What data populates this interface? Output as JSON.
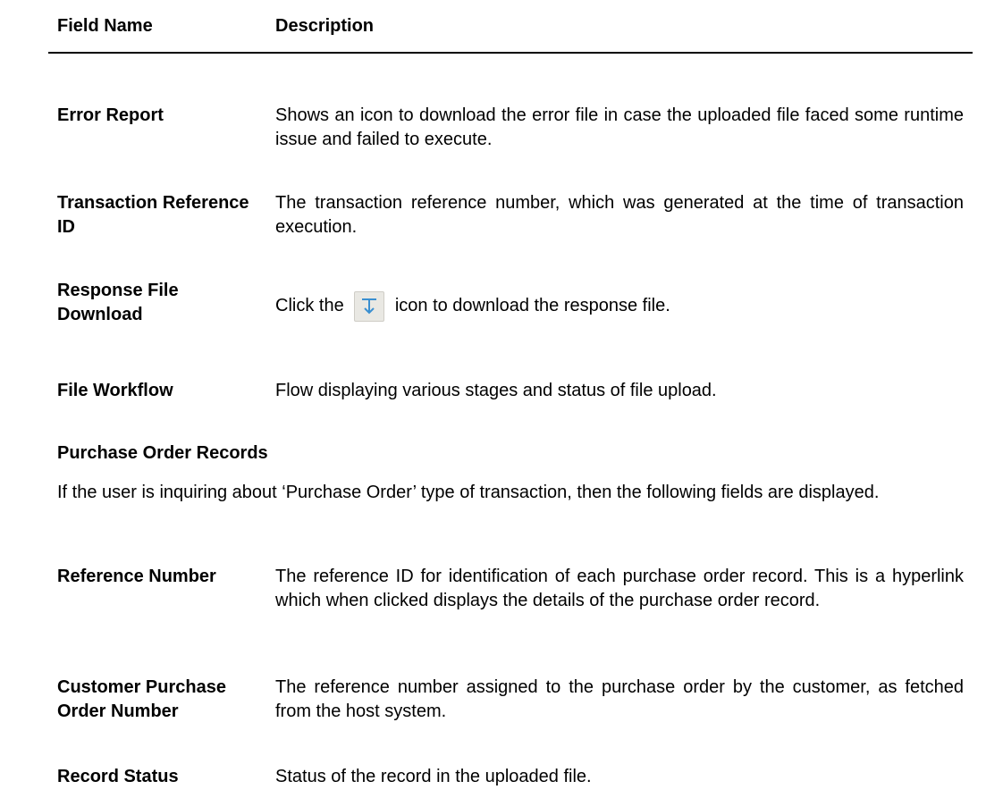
{
  "table_header": {
    "field_name": "Field Name",
    "description": "Description"
  },
  "rows_top": [
    {
      "name": "Error Report",
      "desc": "Shows an icon to download the error file in case the uploaded file faced some runtime issue and failed to execute."
    },
    {
      "name": "Transaction Reference ID",
      "desc": "The transaction reference number, which was generated at the time of transaction execution."
    },
    {
      "name": "Response File Download",
      "desc_before": "Click the",
      "icon": "download-icon",
      "desc_after": "icon to download the response file."
    },
    {
      "name": "File Workflow",
      "desc": "Flow displaying various stages and status of file upload."
    }
  ],
  "section": {
    "title": "Purchase Order Records",
    "intro": "If the user is inquiring about ‘Purchase Order’ type of transaction, then the following fields are displayed."
  },
  "rows_bottom": [
    {
      "name": "Reference Number",
      "desc": "The reference ID for identification of each purchase order record. This is a hyperlink which when clicked displays the details of the purchase order record."
    },
    {
      "name": "Customer Purchase Order Number",
      "desc": "The reference number assigned to the purchase order by the customer, as fetched from the host system."
    },
    {
      "name": "Record Status",
      "desc": "Status of the record in the uploaded file."
    }
  ],
  "colors": {
    "icon_stroke": "#3a8fd0",
    "icon_bg": "#e9e8e3"
  }
}
